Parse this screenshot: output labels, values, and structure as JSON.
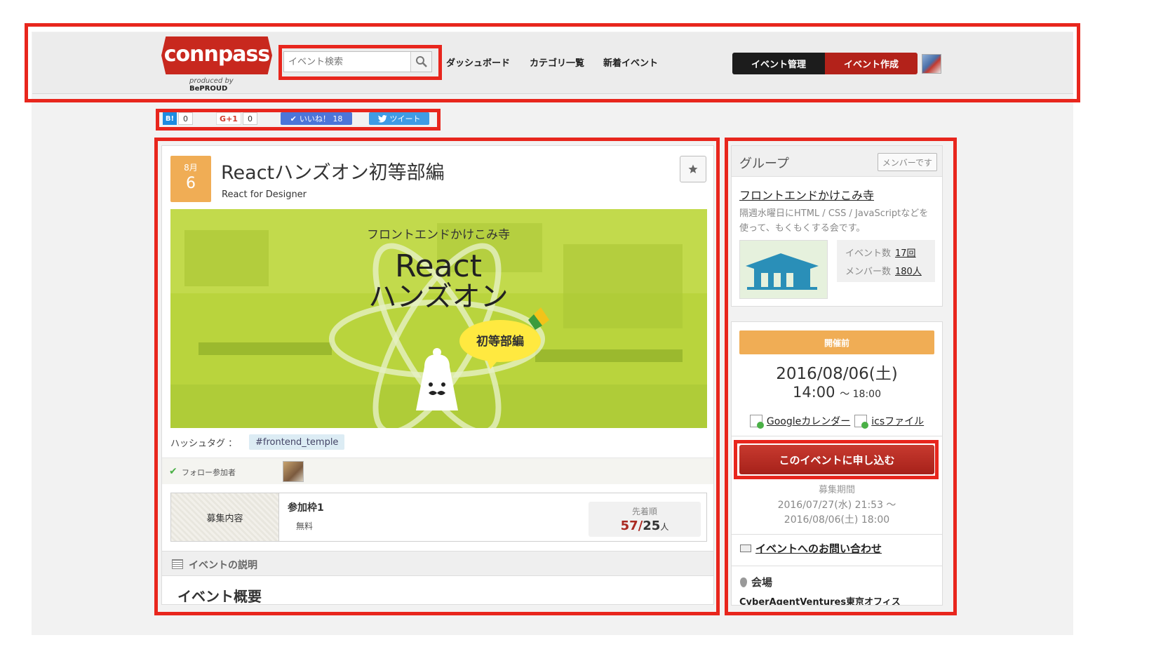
{
  "header": {
    "logo_text": "connpass",
    "logo_sub_prefix": "produced by",
    "logo_sub_brand": "BePROUD",
    "search_placeholder": "イベント検索",
    "nav": [
      "ダッシュボード",
      "カテゴリ一覧",
      "新着イベント"
    ],
    "manage_label": "イベント管理",
    "create_label": "イベント作成"
  },
  "social": {
    "hatena_label": "B!",
    "hatena_count": "0",
    "gplus_label": "G+1",
    "gplus_count": "0",
    "like_label": "いいね！ 18",
    "tweet_label": "ツイート"
  },
  "event": {
    "month": "8月",
    "day": "6",
    "title": "Reactハンズオン初等部編",
    "subtitle": "React for Designer",
    "hero": {
      "group_line": "フロントエンドかけこみ寺",
      "line1": "React",
      "line2": "ハンズオン",
      "bubble": "初等部編"
    },
    "hashtag_label": "ハッシュタグ ：",
    "hashtag": "#frontend_temple",
    "follow_label": "フォロー参加者",
    "recruit_label": "募集内容",
    "slot_name": "参加枠1",
    "slot_fee": "無料",
    "order_type": "先着順",
    "participants": "57",
    "capacity": "25",
    "unit": "人",
    "desc_header": "イベントの説明",
    "overview_heading": "イベント概要"
  },
  "sidebar": {
    "group_title": "グループ",
    "member_label": "メンバーです",
    "group_name": "フロントエンドかけこみ寺",
    "group_desc": "隔週水曜日にHTML / CSS / JavaScriptなどを使って、もくもくする会です。",
    "event_count_label": "イベント数",
    "event_count": "17回",
    "member_count_label": "メンバー数",
    "member_count": "180人",
    "status": "開催前",
    "date": "2016/08/06(土)",
    "time_start": "14:00",
    "time_end": "～ 18:00",
    "google_cal": "Googleカレンダー",
    "ics": "icsファイル",
    "apply_label": "このイベントに申し込む",
    "period_label": "募集期間",
    "period_start": "2016/07/27(水) 21:53 ～",
    "period_end": "2016/08/06(土) 18:00",
    "contact": "イベントへのお問い合わせ",
    "venue_label": "会場",
    "venue_name": "CyberAgentVentures東京オフィス"
  },
  "colors": {
    "highlight": "#e8261d",
    "brand_red": "#c8281e",
    "date_orange": "#f0ad55",
    "hero_green": "#b7d33b"
  }
}
